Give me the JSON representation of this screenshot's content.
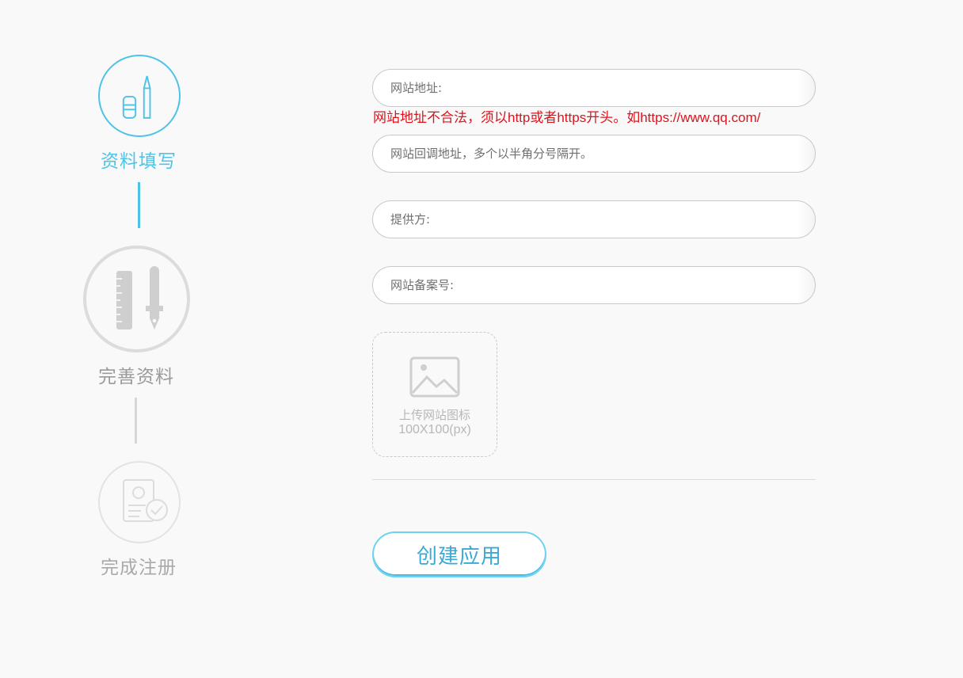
{
  "steps": [
    {
      "label": "资料填写",
      "icon": "pencil-eraser-icon",
      "state": "active",
      "color": "#4fc3e6"
    },
    {
      "label": "完善资料",
      "icon": "ruler-pen-icon",
      "state": "pending",
      "color": "#9a9a9a"
    },
    {
      "label": "完成注册",
      "icon": "profile-check-icon",
      "state": "pending",
      "color": "#a9a9a9"
    }
  ],
  "form": {
    "website_url": {
      "placeholder": "网站地址:",
      "value": ""
    },
    "website_url_error": "网站地址不合法，须以http或者https开头。如https://www.qq.com/",
    "callback_url": {
      "placeholder": "网站回调地址，多个以半角分号隔开。",
      "value": ""
    },
    "provider": {
      "placeholder": "提供方:",
      "value": ""
    },
    "icp_number": {
      "placeholder": "网站备案号:",
      "value": ""
    },
    "upload": {
      "icon": "image-icon",
      "label": "上传网站图标",
      "size_hint": "100X100(px)"
    },
    "submit_label": "创建应用"
  },
  "colors": {
    "accent": "#4fc3e6",
    "error": "#e0121b",
    "inactive": "#dcdcdc",
    "background": "#f9f9f9"
  }
}
